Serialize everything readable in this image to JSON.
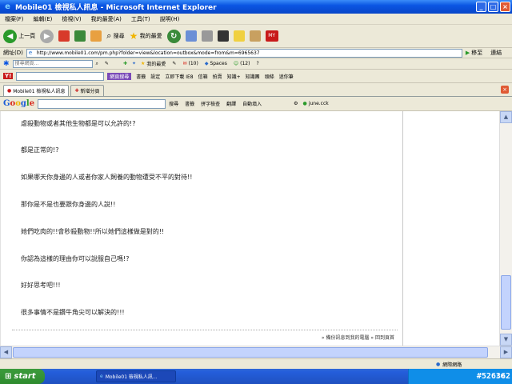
{
  "window": {
    "title": "Mobile01 檢視私人訊息 - Microsoft Internet Explorer"
  },
  "menubar": {
    "items": [
      "檔案(F)",
      "編輯(E)",
      "檢視(V)",
      "我的最愛(A)",
      "工具(T)",
      "說明(H)"
    ]
  },
  "toolbar": {
    "back": "上一頁",
    "search": "搜尋",
    "favorites": "我的最愛"
  },
  "address": {
    "label": "網址(D)",
    "url": "http://www.mobile01.com/pm.php?folder=view&location=outbox&mode=from&m=6965637",
    "go": "移至",
    "links": "連結"
  },
  "bar2": {
    "search_placeholder": "搜尋網頁...",
    "favorites": "我的最愛",
    "mail_count": "(10)",
    "spaces": "Spaces",
    "people_count": "(12)"
  },
  "bar3": {
    "webpage": "網頁搜尋",
    "bookmark": "書籤",
    "settings": "設定",
    "ie8": "立即下載 IE8",
    "mail": "信箱",
    "auction": "拍賣",
    "knowledge": "知識+",
    "knowledge_hall": "知識團",
    "news": "頭條",
    "more": "迷你筆"
  },
  "tabs": {
    "active": "Mobile01 檢視私人訊息",
    "new_tab": "新增分頁"
  },
  "googlebar": {
    "search": "搜尋",
    "bookmark": "書籤",
    "spellcheck": "拼字檢查",
    "translate": "翻譯",
    "autofill": "自動填入",
    "user": "june.cck"
  },
  "message": {
    "lines": [
      "虐殺動物或者其他生物都是可以允許的!?",
      "都是正常的!?",
      "如果哪天你身邊的人或者你家人飼養的動物遭受不平的對待!!",
      "那你是不是也要跟你身邊的人說!!",
      "她們吃肉的!!會秒殺動物!!所以她們這樣做是對的!!",
      "你認為這樣的理由你可以說服自己嗎!?",
      "好好思考吧!!!",
      "很多事情不是鑽牛角尖可以解決的!!!"
    ]
  },
  "footer_links": {
    "backup": "» 備份訊息到我的電腦",
    "top": "» 回到頁首"
  },
  "status": {
    "zone": "網際網路"
  },
  "taskbar": {
    "start": "start",
    "task": "Mobile01 檢視私人訊...",
    "lang": "CH"
  },
  "watermark": "#526362"
}
